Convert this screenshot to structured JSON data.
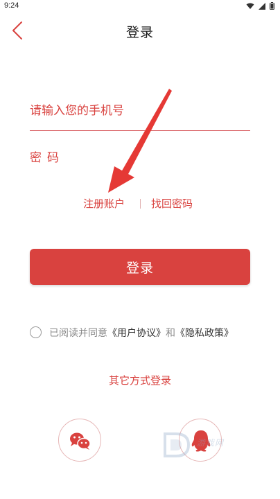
{
  "status_bar": {
    "time": "9:24"
  },
  "header": {
    "title": "登录",
    "back_icon": "chevron-left-icon"
  },
  "form": {
    "phone_placeholder": "请输入您的手机号",
    "password_placeholder": "密码"
  },
  "links": {
    "register": "注册账户",
    "recover": "找回密码"
  },
  "login_button": "登录",
  "agreement": {
    "prefix": "已阅读并同意",
    "user_agreement": "《用户协议》",
    "conjunction": "和",
    "privacy_policy": "《隐私政策》",
    "checked": false
  },
  "other_login": {
    "title": "其它方式登录",
    "options": [
      {
        "name": "wechat",
        "icon": "wechat-icon"
      },
      {
        "name": "qq",
        "icon": "qq-icon"
      }
    ]
  },
  "watermark": {
    "text": "游戏网"
  },
  "colors": {
    "accent": "#d9423f",
    "text_dark": "#1a1a1a",
    "text_muted": "#888888"
  }
}
